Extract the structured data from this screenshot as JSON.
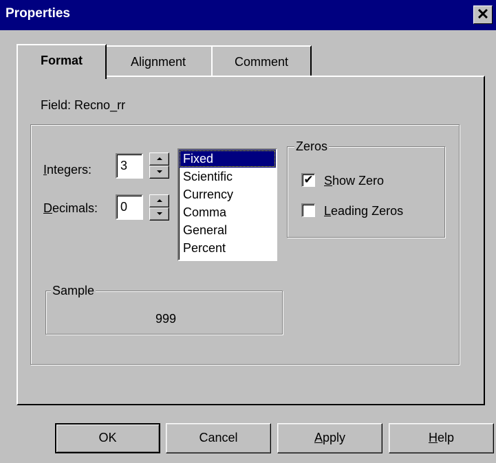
{
  "window": {
    "title": "Properties",
    "close_glyph": "✕",
    "colors": {
      "titlebar": "#000080",
      "face": "#c0c0c0",
      "selection": "#000080"
    }
  },
  "tabs": [
    {
      "label": "Format",
      "selected": true
    },
    {
      "label": "Alignment",
      "selected": false
    },
    {
      "label": "Comment",
      "selected": false
    }
  ],
  "field": {
    "label": "Field:",
    "value": "Recno_rr"
  },
  "integers": {
    "label_mnemonic": "I",
    "label_rest": "ntegers:",
    "value": "3"
  },
  "decimals": {
    "label_mnemonic": "D",
    "label_rest": "ecimals:",
    "value": "0"
  },
  "format_list": {
    "items": [
      "Fixed",
      "Scientific",
      "Currency",
      "Comma",
      "General",
      "Percent"
    ],
    "selected": "Fixed"
  },
  "zeros": {
    "title": "Zeros",
    "show_zero": {
      "label_mnemonic": "S",
      "label_rest": "how Zero",
      "checked": true,
      "mark": "✔"
    },
    "leading_zeros": {
      "label_mnemonic": "L",
      "label_rest": "eading Zeros",
      "checked": false,
      "mark": ""
    }
  },
  "sample": {
    "title": "Sample",
    "value": "999"
  },
  "buttons": {
    "ok": "OK",
    "cancel": "Cancel",
    "apply": {
      "mnemonic": "A",
      "rest": "pply"
    },
    "help": {
      "mnemonic": "H",
      "rest": "elp"
    }
  }
}
